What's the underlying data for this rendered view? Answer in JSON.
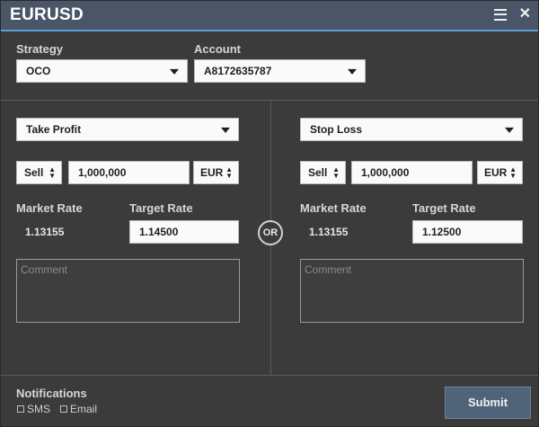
{
  "window": {
    "title": "EURUSD",
    "menu_icon": "hamburger-menu-icon",
    "close_icon": "close-icon"
  },
  "strategy": {
    "label": "Strategy",
    "value": "OCO"
  },
  "account": {
    "label": "Account",
    "value": "A8172635787"
  },
  "left": {
    "order_type": "Take Profit",
    "side": "Sell",
    "amount": "1,000,000",
    "currency": "EUR",
    "market_rate_label": "Market Rate",
    "market_rate": "1.13155",
    "target_rate_label": "Target Rate",
    "target_rate": "1.14500",
    "comment_placeholder": "Comment"
  },
  "right": {
    "order_type": "Stop Loss",
    "side": "Sell",
    "amount": "1,000,000",
    "currency": "EUR",
    "market_rate_label": "Market Rate",
    "market_rate": "1.13155",
    "target_rate_label": "Target Rate",
    "target_rate": "1.12500",
    "comment_placeholder": "Comment"
  },
  "or_label": "OR",
  "notifications": {
    "label": "Notifications",
    "sms_label": "SMS",
    "email_label": "Email",
    "sms_checked": false,
    "email_checked": false
  },
  "submit_label": "Submit",
  "colors": {
    "titlebar": "#4a5668",
    "accent": "#5aa0d8",
    "background": "#3b3b3b",
    "submit": "#4f6379"
  }
}
